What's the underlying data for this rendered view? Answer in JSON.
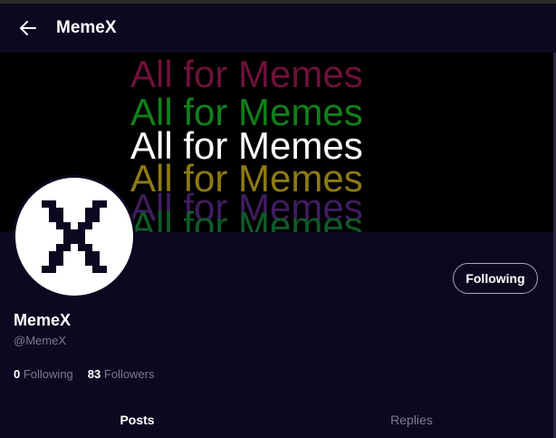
{
  "header": {
    "title": "MemeX"
  },
  "banner": {
    "text": "All for Memes",
    "colors": [
      "#6e1139",
      "#10801a",
      "#ffffff",
      "#8e7a12",
      "#3f1d5e",
      "#0f5a2a"
    ]
  },
  "profile": {
    "name": "MemeX",
    "handle": "@MemeX",
    "follow_button": "Following",
    "following_count": "0",
    "following_label": "Following",
    "followers_count": "83",
    "followers_label": "Followers"
  },
  "tabs": [
    {
      "label": "Posts",
      "active": true
    },
    {
      "label": "Replies",
      "active": false
    }
  ],
  "colors": {
    "background": "#0e0720",
    "muted": "#7f7a8e"
  },
  "icons": {
    "back": "arrow-left-icon",
    "logo": "x-logo-icon"
  }
}
